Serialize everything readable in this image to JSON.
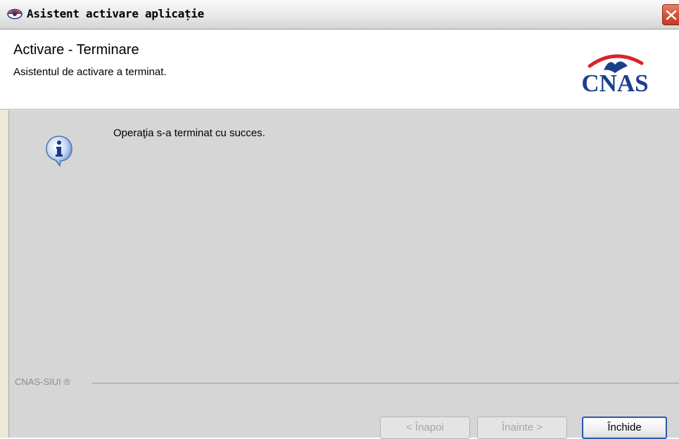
{
  "window": {
    "title": "Asistent activare aplicație",
    "icons": {
      "app": "eye-logo-icon",
      "close": "close-icon"
    }
  },
  "header": {
    "title": "Activare - Terminare",
    "subtitle": "Asistentul de activare a terminat.",
    "logo_text": "CNAS",
    "logo_colors": {
      "text": "#1c3f8c",
      "arc": "#d8232a",
      "bird": "#1c3f8c"
    }
  },
  "content": {
    "icon": "info-icon",
    "message": "Operaţia s-a terminat cu succes."
  },
  "footer": {
    "brand": "CNAS-SIUI ®",
    "buttons": {
      "back": "< Înapoi",
      "next": "Înainte >",
      "close": "Închide"
    }
  },
  "colors": {
    "accent": "#2a5aa8",
    "close_button": "#d4543a",
    "panel_bg": "#d6d6d6"
  }
}
